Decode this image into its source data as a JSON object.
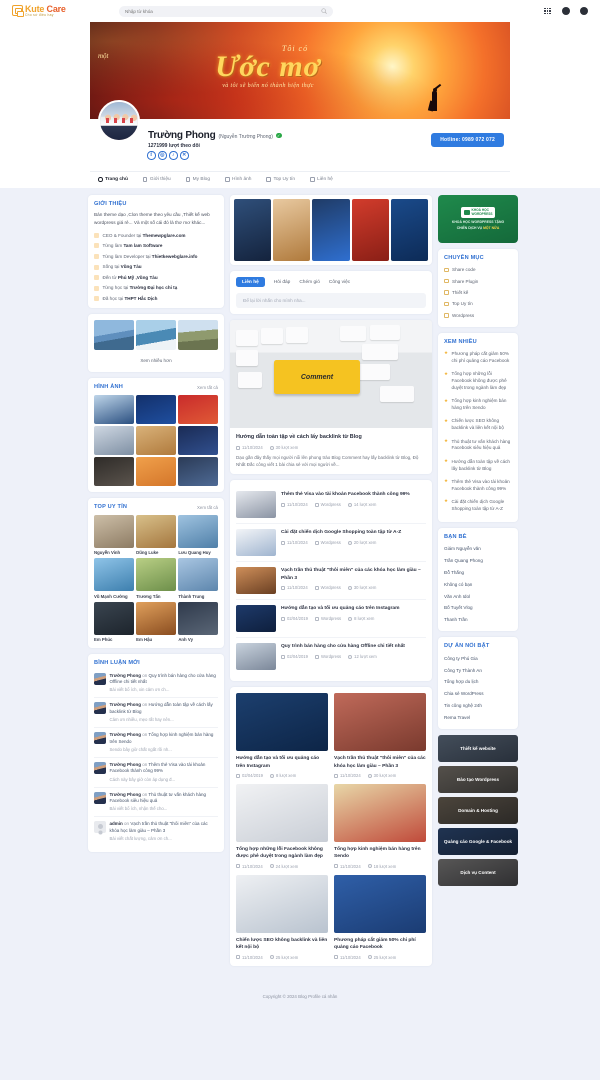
{
  "topbar": {
    "logo_main": "Kute",
    "logo_accent": "Care",
    "logo_sub": "Cho sứ điều hay",
    "search_placeholder": "Nhập từ khóa",
    "icons": [
      "grid-icon",
      "messages-icon",
      "notifications-icon"
    ]
  },
  "hero": {
    "pre": "một",
    "line_small_top": "Tôi có",
    "line_big": "Ước mơ",
    "line_sub": "và tôi sẽ biến nó thành hiện thực"
  },
  "profile": {
    "name": "Trường Phong",
    "alias": "(Nguyễn Trường Phong)",
    "followers": "1271999 lượt theo dõi",
    "socials": [
      "facebook-icon",
      "instagram-icon",
      "tiktok-icon",
      "x-icon"
    ],
    "hotline": "Hotline: 0989 072 072",
    "tabs": [
      {
        "label": "Trang chủ",
        "active": true
      },
      {
        "label": "Giới thiệu",
        "active": false
      },
      {
        "label": "My Blog",
        "active": false
      },
      {
        "label": "Hình ảnh",
        "active": false
      },
      {
        "label": "Top Uy tín",
        "active": false
      },
      {
        "label": "Liên hệ",
        "active": false
      }
    ]
  },
  "left": {
    "intro": {
      "title": "Giới thiệu",
      "paragraph": "Bán theme dạo ,Clon theme theo yêu cầu ,Thiết kế web wordpress giá rẻ... Và một số cái đó là thơ mơ khác...",
      "items": [
        {
          "pre": "CEO & Founder tại ",
          "bold": "Themewpglare.com",
          "post": ""
        },
        {
          "pre": "Từng làm ",
          "bold": "Tam lam Software",
          "post": ""
        },
        {
          "pre": "Từng làm Developer tại ",
          "bold": "Thietkewebglare.info",
          "post": ""
        },
        {
          "pre": "Sống tại ",
          "bold": "Vũng Tàu",
          "post": ""
        },
        {
          "pre": "Đến từ ",
          "bold": "Phú Mỹ ,Vũng Tàu",
          "post": ""
        },
        {
          "pre": "Từng học tại ",
          "bold": "Trường Đại học chi tạ",
          "post": ""
        },
        {
          "pre": "Đã học tại ",
          "bold": "THPT Hắc Dịch",
          "post": ""
        }
      ],
      "more_label": "Xem nhiều hơn"
    },
    "gallery": {
      "title": "Hình ảnh",
      "see_all": "Xem tất cả",
      "captions": []
    },
    "top_trusted": {
      "title": "Top uy tín",
      "see_all": "Xem tất cả",
      "people": [
        "Nguyễn Vinh",
        "Dũng Luke",
        "Lưu Quang Huy",
        "Vũ Mạnh Cường",
        "Trương Tấn",
        "Thành Trung",
        "Em Phúc",
        "Em Hậu",
        "Anh Vy"
      ]
    },
    "comments": {
      "title": "Bình luận mới",
      "items": [
        {
          "who": "Trường Phong",
          "on": "on",
          "post": "Quy trình bán hàng cho cửa hàng Offline chi tiết nhất",
          "text": "Bài viết bổ ích, xin cảm ơn ch..."
        },
        {
          "who": "Trường Phong",
          "on": "on",
          "post": "Hướng dẫn toàn tập về cách lấy backlink từ Blog",
          "text": "Cảm ơn nhiều, mẹo rất hay nên..."
        },
        {
          "who": "Trường Phong",
          "on": "on",
          "post": "Tổng hợp kinh nghiệm bán hàng trên Sendo",
          "text": "Sendo bây giờ chất ngất rồi nh..."
        },
        {
          "who": "Trường Phong",
          "on": "on",
          "post": "Thêm thẻ Visa vào tài khoản Facebook thành công 99%",
          "text": "Cách này bây giờ còn áp dụng đ..."
        },
        {
          "who": "Trường Phong",
          "on": "on",
          "post": "Thủ thuật tư vấn khách hàng Facebook siêu hiệu quả",
          "text": "Bài viết bổ ích, nhận thế cho..."
        },
        {
          "who": "admin",
          "on": "on",
          "post": "Vạch trần thủ thuật \"thôi miên\" của các khóa học làm giàu – Phần 3",
          "text": "Bài viết chất lượng, cảm ơn ch..."
        }
      ]
    }
  },
  "middle": {
    "compose": {
      "tabs": [
        "Liên hệ",
        "Hỏi đáp",
        "Chém gió",
        "Công việc"
      ],
      "placeholder": "Để lại lời nhắn cho mình nha..."
    },
    "feature": {
      "title": "Hướng dẫn toàn tập về cách lấy backlink từ Blog",
      "date": "11/10/2024",
      "views": "30 lượt xem",
      "desc": "Dạo gần đây thấy mọi người nổi lên phong trào Blog Comment hay lấy backlink từ Blog, Độ Nhất Đắc công viết 1 bài chia sẻ với mọi người về..."
    },
    "list": [
      {
        "title": "Thêm thẻ Visa vào tài khoản Facebook thành công 99%",
        "date": "11/10/2024",
        "cat": "Wordpress",
        "views": "14 lượt xem"
      },
      {
        "title": "Cài đặt chiến dịch Google Shopping toàn tập từ A-Z",
        "date": "11/10/2024",
        "cat": "Wordpress",
        "views": "20 lượt xem"
      },
      {
        "title": "Vạch trần thủ thuật \"thôi miên\" của các khóa học làm giàu – Phần 3",
        "date": "11/10/2024",
        "cat": "Wordpress",
        "views": "30 lượt xem"
      },
      {
        "title": "Hướng dẫn tạo và tối ưu quảng cáo trên Instagram",
        "date": "02/04/2019",
        "cat": "Wordpress",
        "views": "8 lượt xem"
      },
      {
        "title": "Quy trình bán hàng cho cửa hàng Offline chi tiết nhất",
        "date": "02/04/2019",
        "cat": "Wordpress",
        "views": "12 lượt xem"
      }
    ],
    "cards": [
      {
        "title": "Hướng dẫn tạo và tối ưu quảng cáo trên Instagram",
        "date": "02/04/2019",
        "views": "8 lượt xem"
      },
      {
        "title": "Vạch trần thủ thuật \"thôi miên\" của các khóa học làm giàu – Phần 3",
        "date": "11/10/2024",
        "views": "30 lượt xem"
      },
      {
        "title": "Tổng hợp những lỗi Facebook không được phê duyệt trong ngành làm đẹp",
        "date": "11/10/2024",
        "views": "24 lượt xem"
      },
      {
        "title": "Tổng hợp kinh nghiệm bán hàng trên Sendo",
        "date": "11/10/2024",
        "views": "18 lượt xem"
      },
      {
        "title": "Chiến lược SEO không backlink và liên kết nội bộ",
        "date": "11/10/2024",
        "views": "25 lượt xem"
      },
      {
        "title": "Phương pháp cắt giảm 50% chi phí quảng cáo Facebook",
        "date": "11/10/2024",
        "views": "25 lượt xem"
      }
    ]
  },
  "right": {
    "promo": {
      "badge_l1": "KHOÁ HỌC",
      "badge_l2": "WORDPRESS",
      "text1": "KHOÁ HỌC WORDPRESS TẶNG",
      "text2": "CHIẾN DỊCH VỤ",
      "highlight": "MỘT NỬA"
    },
    "categories": {
      "title": "Chuyên mục",
      "items": [
        "Share code",
        "Share Plugin",
        "Thiết kế",
        "Top Uy tín",
        "Wordpress"
      ]
    },
    "popular": {
      "title": "Xem nhiều",
      "items": [
        "Phương pháp cắt giảm 50% chi phí quảng cáo Facebook",
        "Tổng hợp những lỗi Facebook không được phê duyệt trong ngành làm đẹp",
        "Tổng hợp kinh nghiệm bán hàng trên Sendo",
        "Chiến lược SEO không backlink và liên kết nội bộ",
        "Thủ thuật tư vấn khách hàng Facebook siêu hiệu quả",
        "Hướng dẫn toàn tập về cách lấy backlink từ Blog",
        "Thêm thẻ Visa vào tài khoản Facebook thành công 99%",
        "Cài đặt chiến dịch Google Shopping toàn tập từ A-Z"
      ]
    },
    "friends": {
      "title": "Bạn bè",
      "items": [
        "Giám Nguyễn văn",
        "Trần Quang Phong",
        "Đỗ Thắng",
        "Không có bạn",
        "Văn Anh Idol",
        "Bố Tuyết Vlog",
        "Thanh Trần"
      ]
    },
    "projects": {
      "title": "Dự án nổi bật",
      "items": [
        "Công ty Phú Gia",
        "Công Ty Thành An",
        "Tổng hợp du lịch",
        "Chia sẻ WordPress",
        "Tin công nghệ 24h",
        "Rema Travel"
      ]
    },
    "banners": [
      {
        "label": "Thiết kế website"
      },
      {
        "label": "Đào tạo Wordpress"
      },
      {
        "label": "Domain & Hosting"
      },
      {
        "label": "Quảng cáo Google & Facebook"
      },
      {
        "label": "Dịch vụ Content"
      }
    ]
  },
  "footer": {
    "text": "Copyright © 2024 Blog Profile cá nhân"
  }
}
